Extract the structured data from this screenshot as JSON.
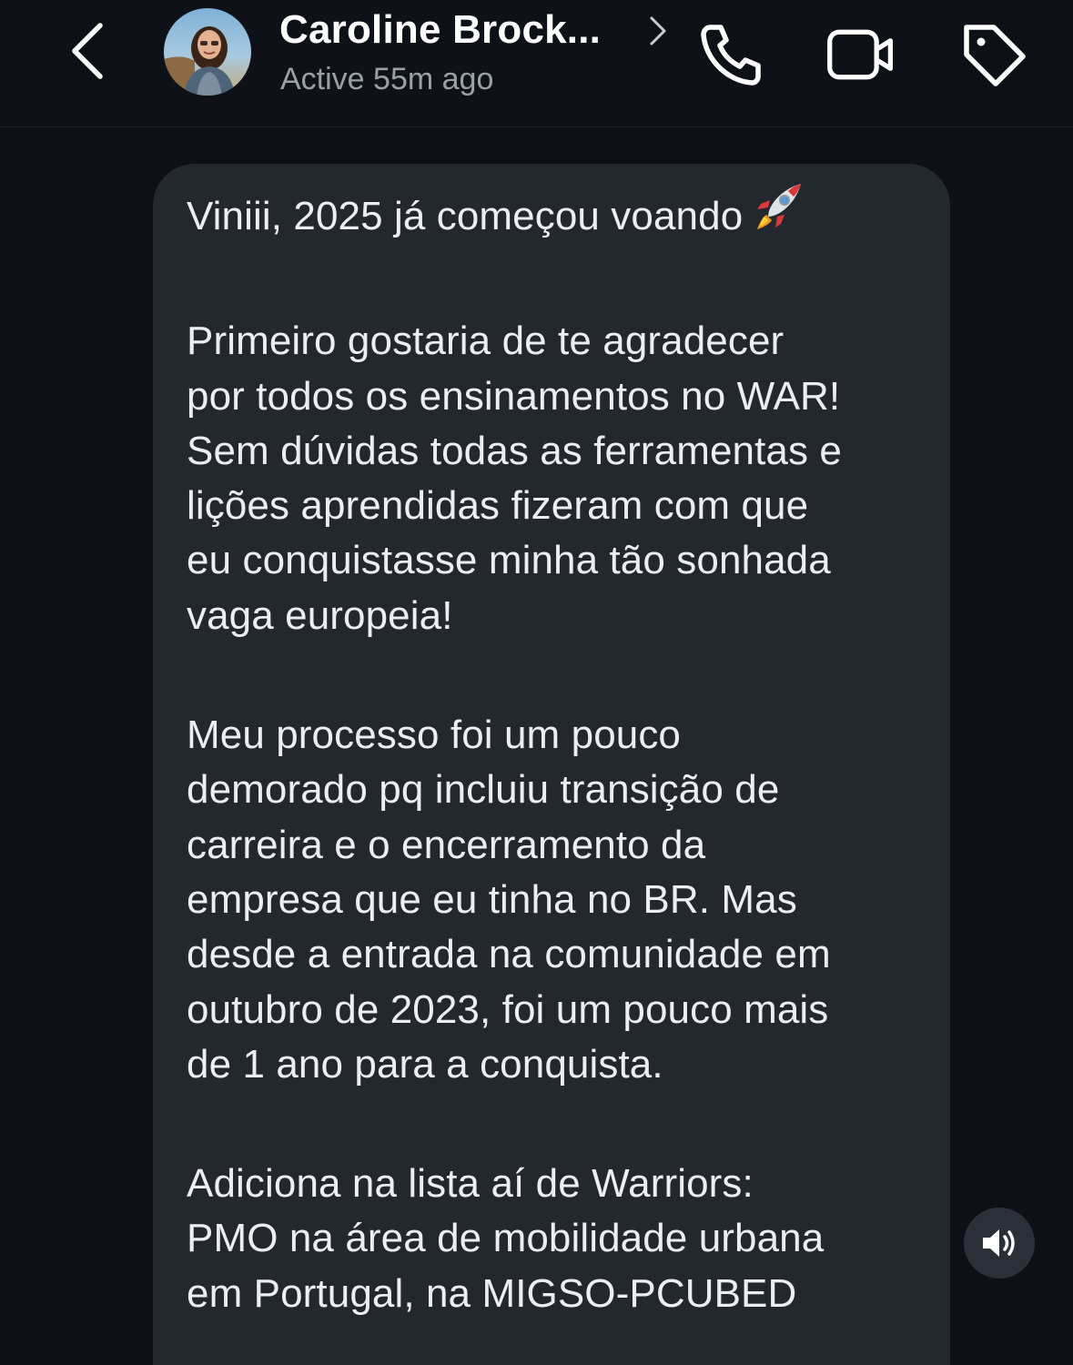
{
  "header": {
    "contact_name": "Caroline Brock...",
    "status": "Active 55m ago",
    "icons": {
      "back": "chevron-left-icon",
      "profile_chevron": "chevron-right-icon",
      "call": "phone-icon",
      "video": "video-camera-icon",
      "tag": "tag-icon"
    }
  },
  "message": {
    "paragraphs": [
      "Viniii, 2025 já começou voando",
      "Primeiro gostaria de te agradecer\npor todos os ensinamentos no WAR!\nSem dúvidas todas as ferramentas e\nlições aprendidas fizeram com que\neu conquistasse minha tão sonhada\nvaga europeia!",
      "Meu processo foi um pouco\ndemorado pq incluiu transição de\ncarreira e o encerramento da\nempresa que eu tinha no BR. Mas\ndesde a entrada na comunidade em\noutubro de 2023, foi um pouco mais\nde 1 ano para a conquista.",
      "Adiciona na lista aí de Warriors:\nPMO na área de mobilidade urbana\nem Portugal, na MIGSO-PCUBED"
    ],
    "emoji": "rocket-icon"
  },
  "floating": {
    "sound_icon": "speaker-icon"
  },
  "colors": {
    "background": "#0d1117",
    "bubble": "#23272e",
    "text": "#eceef1",
    "secondary_text": "#9aa0a8"
  }
}
